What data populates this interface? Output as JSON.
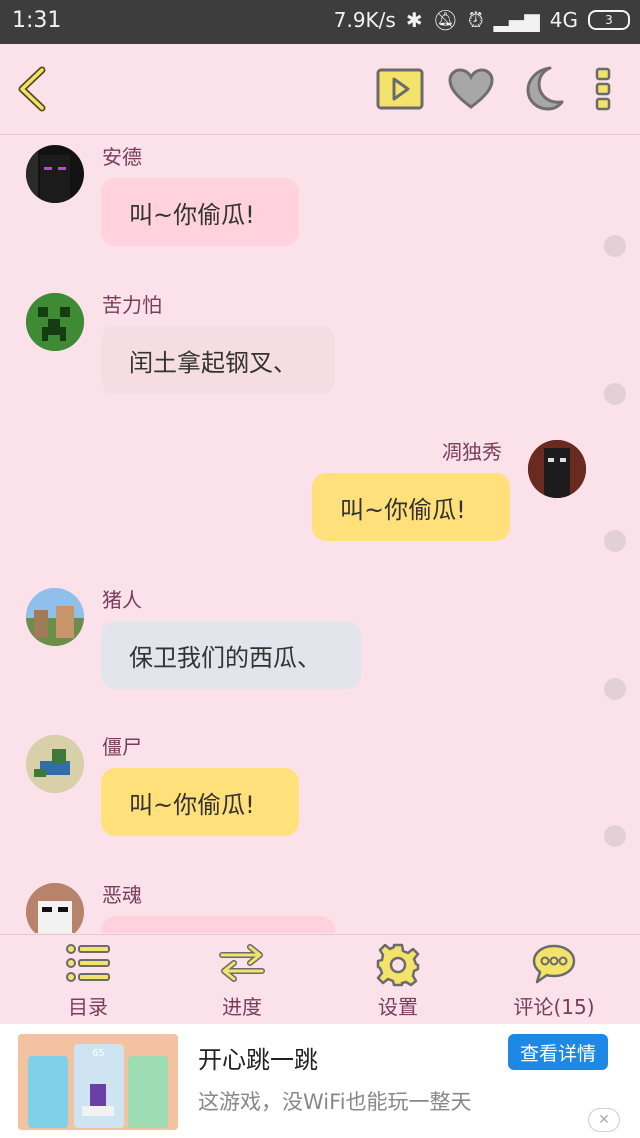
{
  "status_bar": {
    "time": "1:31",
    "network_speed": "7.9K/s",
    "signal": "4G",
    "battery": "3"
  },
  "toolbar": {
    "back_icon": "chevron-left-icon",
    "play_icon": "play-icon",
    "like_icon": "heart-icon",
    "night_icon": "moon-icon",
    "more_icon": "more-vertical-icon",
    "accent_color": "#f3e36b"
  },
  "messages": [
    {
      "sender": "安德",
      "text": "叫~你偷瓜!",
      "side": "left",
      "bubble_color": "#ffd2de"
    },
    {
      "sender": "苦力怕",
      "text": "闰土拿起钢叉、",
      "side": "left",
      "bubble_color": "#f5dde3"
    },
    {
      "sender": "凋独秀",
      "text": "叫~你偷瓜!",
      "side": "right",
      "bubble_color": "#ffe07a"
    },
    {
      "sender": "猪人",
      "text": "保卫我们的西瓜、",
      "side": "left",
      "bubble_color": "#e3e4ec"
    },
    {
      "sender": "僵尸",
      "text": "叫~你偷瓜!",
      "side": "left",
      "bubble_color": "#ffe07a"
    },
    {
      "sender": "恶魂",
      "text": "",
      "side": "left",
      "bubble_color": "#ffd2de"
    }
  ],
  "bottom_nav": [
    {
      "label": "目录",
      "icon": "list-icon"
    },
    {
      "label": "进度",
      "icon": "swap-arrows-icon"
    },
    {
      "label": "设置",
      "icon": "gear-icon"
    },
    {
      "label": "评论(15)",
      "icon": "comment-bubble-icon"
    }
  ],
  "ad": {
    "title": "开心跳一跳",
    "description": "这游戏，没WiFi也能玩一整天",
    "button_label": "查看详情",
    "close_icon": "close-icon",
    "thumb_text": "65"
  }
}
